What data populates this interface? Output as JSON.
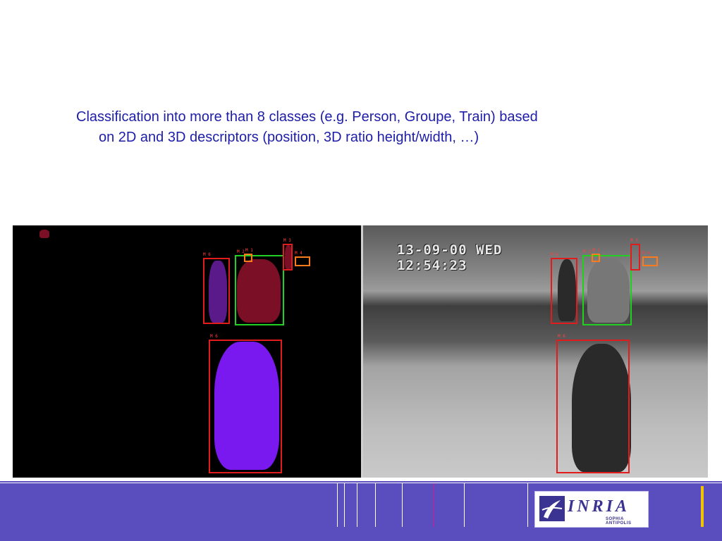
{
  "caption": {
    "line1": "Classification into more than 8 classes (e.g. Person, Groupe, Train) based",
    "line2": "on 2D and 3D descriptors (position, 3D ratio height/width, …)"
  },
  "video": {
    "date_overlay": "13-09-00 WED",
    "time_overlay": "12:54:23",
    "track_labels": [
      "M 6",
      "M 2",
      "M 1",
      "M 3",
      "M 4",
      "M 6"
    ]
  },
  "logo": {
    "wordmark": "INRIA",
    "subtitle": "SOPHIA ANTIPOLIS"
  },
  "colors": {
    "text": "#1d1da8",
    "footer": "#5a4dbd",
    "box_person": "#e01c1c",
    "box_group": "#22d022",
    "box_object": "#ff7a1a",
    "mask_violet": "#7a18f0",
    "mask_red": "#7a0f25",
    "accent_yellow": "#f2c300"
  }
}
